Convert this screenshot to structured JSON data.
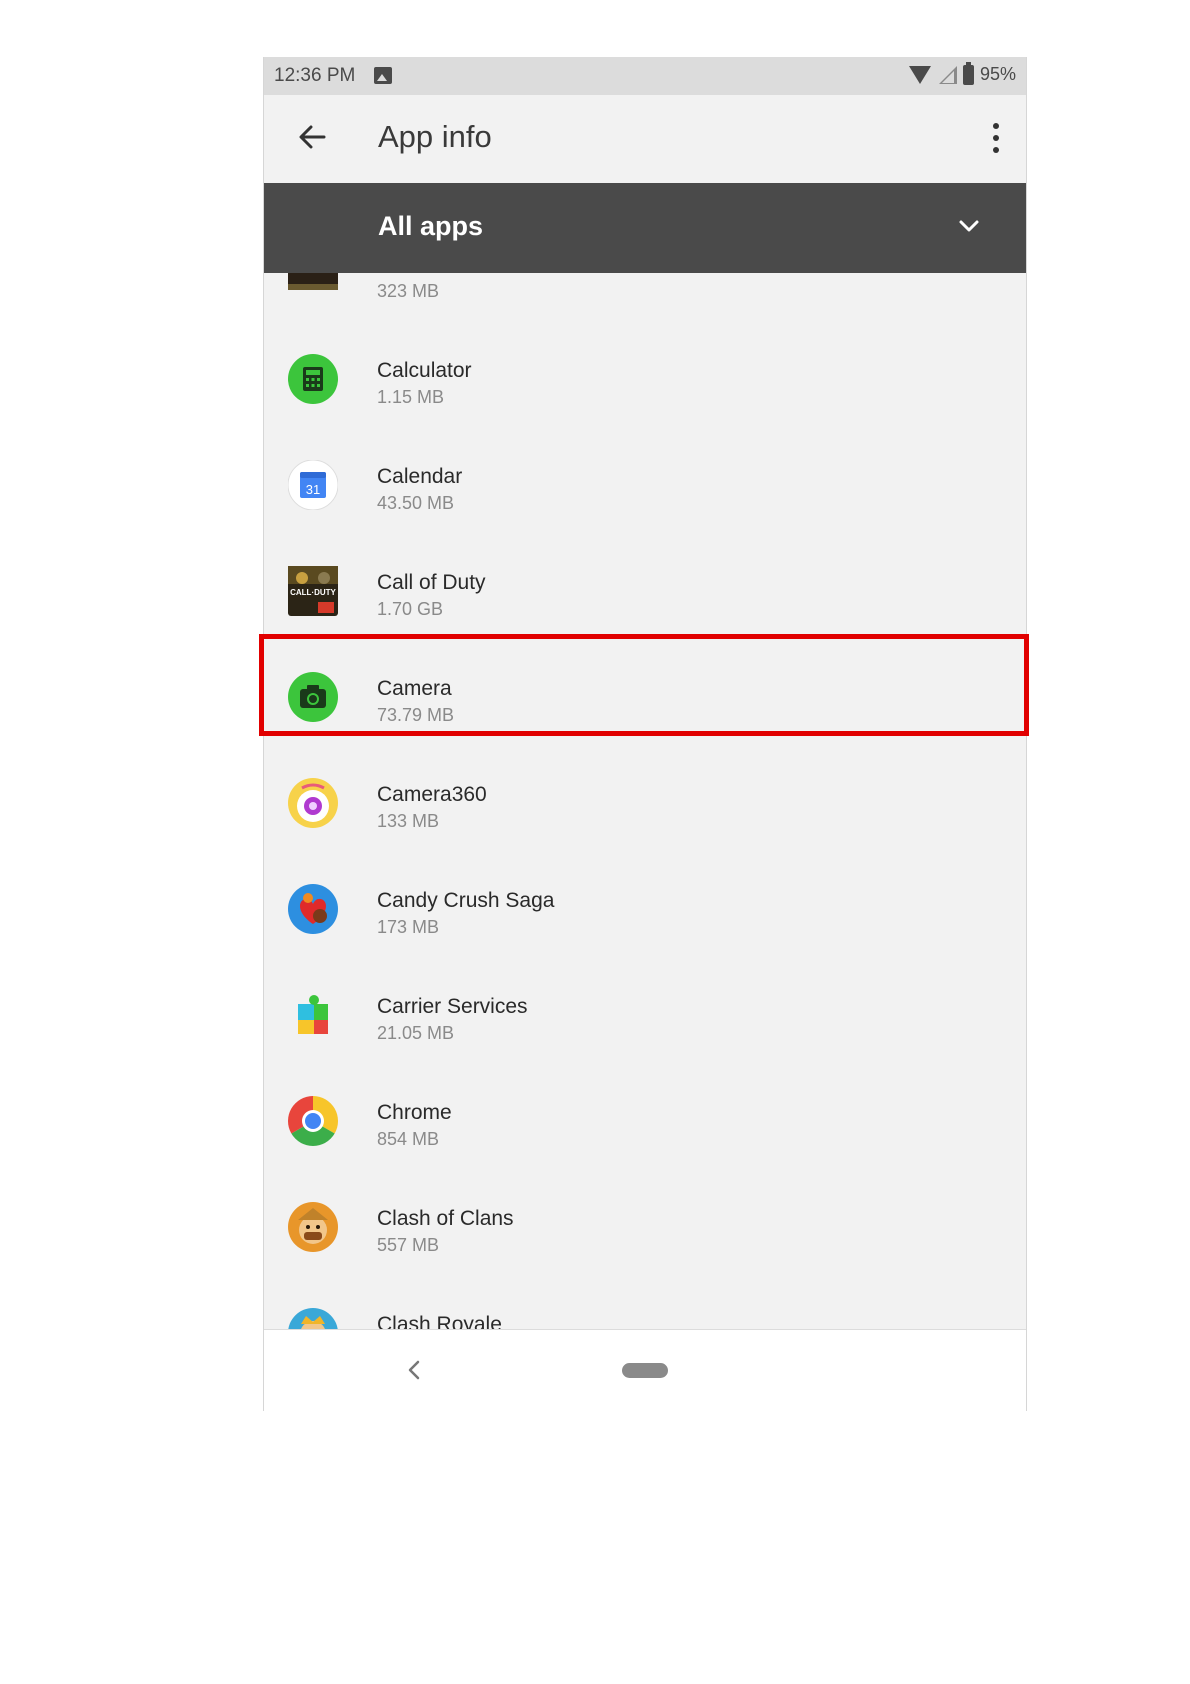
{
  "status_bar": {
    "time": "12:36 PM",
    "battery": "95%"
  },
  "app_bar": {
    "title": "App info"
  },
  "filter": {
    "label": "All apps"
  },
  "apps": [
    {
      "name": "",
      "size": "323 MB",
      "icon": "game-thumbnail-icon"
    },
    {
      "name": "Calculator",
      "size": "1.15 MB",
      "icon": "calculator-icon"
    },
    {
      "name": "Calendar",
      "size": "43.50 MB",
      "icon": "calendar-icon",
      "icon_text": "31"
    },
    {
      "name": "Call of Duty",
      "size": "1.70 GB",
      "icon": "call-of-duty-icon",
      "icon_text": "CALL·DUTY"
    },
    {
      "name": "Camera",
      "size": "73.79 MB",
      "icon": "camera-icon",
      "highlighted": true
    },
    {
      "name": "Camera360",
      "size": "133 MB",
      "icon": "camera360-icon"
    },
    {
      "name": "Candy Crush Saga",
      "size": "173 MB",
      "icon": "candy-crush-icon"
    },
    {
      "name": "Carrier Services",
      "size": "21.05 MB",
      "icon": "carrier-services-icon"
    },
    {
      "name": "Chrome",
      "size": "854 MB",
      "icon": "chrome-icon"
    },
    {
      "name": "Clash of Clans",
      "size": "557 MB",
      "icon": "clash-of-clans-icon"
    },
    {
      "name": "Clash Royale",
      "size": "",
      "icon": "clash-royale-icon"
    }
  ],
  "colors": {
    "highlight": "#e10000",
    "filter_bar": "#4a4a4a",
    "list_bg": "#f2f2f2"
  }
}
